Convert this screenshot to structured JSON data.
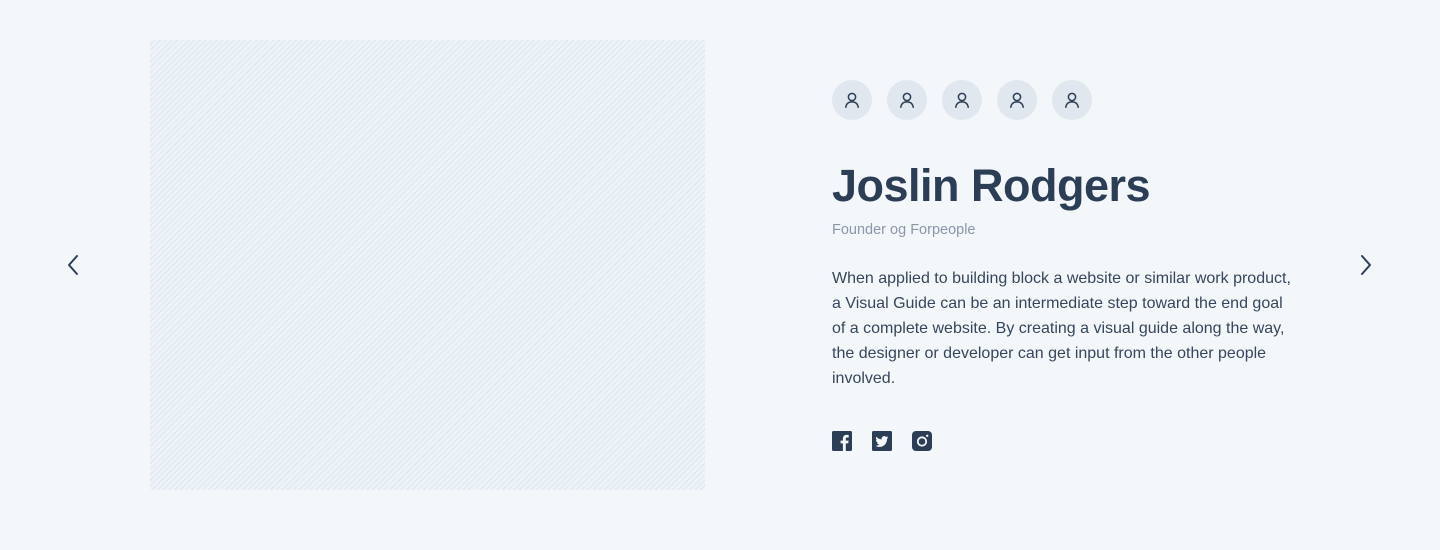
{
  "profile": {
    "name": "Joslin Rodgers",
    "role": "Founder og Forpeople",
    "bio": "When applied to building block a website or similar work product, a Visual Guide can be an intermediate step toward the end goal of a complete website. By creating a visual guide along the way, the designer or developer can get input from the other people involved."
  },
  "avatars": [
    {
      "icon": "user-icon"
    },
    {
      "icon": "user-icon"
    },
    {
      "icon": "user-icon"
    },
    {
      "icon": "user-icon"
    },
    {
      "icon": "user-icon"
    }
  ],
  "social": [
    {
      "icon": "facebook-icon"
    },
    {
      "icon": "twitter-icon"
    },
    {
      "icon": "instagram-icon"
    }
  ],
  "navigation": {
    "prev_icon": "chevron-left-icon",
    "next_icon": "chevron-right-icon"
  },
  "colors": {
    "background": "#f4f7fa",
    "text_primary": "#2c3e55",
    "text_muted": "#8a97a8",
    "avatar_bg": "#e1e7ef",
    "placeholder_stripe": "#dde6f0"
  }
}
